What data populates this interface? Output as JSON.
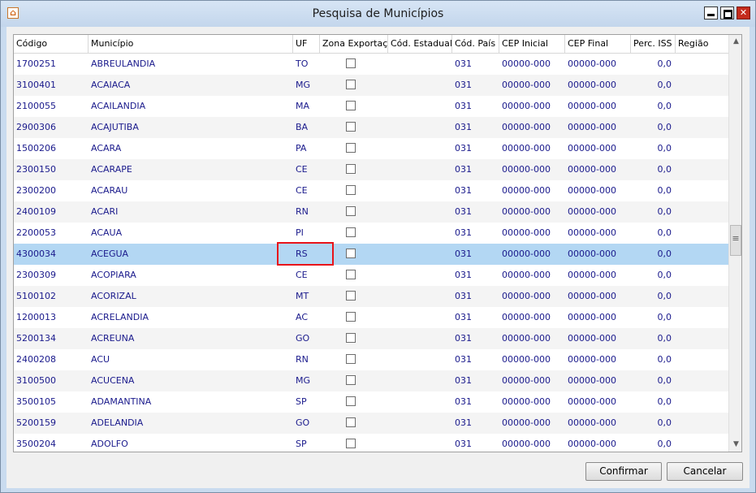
{
  "window": {
    "title": "Pesquisa de Municípios"
  },
  "titlebar_buttons": {
    "minimize": "minimize-icon",
    "maximize": "maximize-icon",
    "close": "✕"
  },
  "grid": {
    "columns": [
      "Código",
      "Município",
      "UF",
      "Zona Exportação",
      "Cód. Estadual",
      "Cód. País",
      "CEP Inicial",
      "CEP Final",
      "Perc. ISS",
      "Região"
    ],
    "selected_row_index": 9,
    "rows": [
      {
        "codigo": "1700251",
        "municipio": "ABREULANDIA",
        "uf": "TO",
        "zona": false,
        "cod_estadual": "",
        "cod_pais": "031",
        "cep_ini": "00000-000",
        "cep_fim": "00000-000",
        "iss": "0,0",
        "regiao": ""
      },
      {
        "codigo": "3100401",
        "municipio": "ACAIACA",
        "uf": "MG",
        "zona": false,
        "cod_estadual": "",
        "cod_pais": "031",
        "cep_ini": "00000-000",
        "cep_fim": "00000-000",
        "iss": "0,0",
        "regiao": ""
      },
      {
        "codigo": "2100055",
        "municipio": "ACAILANDIA",
        "uf": "MA",
        "zona": false,
        "cod_estadual": "",
        "cod_pais": "031",
        "cep_ini": "00000-000",
        "cep_fim": "00000-000",
        "iss": "0,0",
        "regiao": ""
      },
      {
        "codigo": "2900306",
        "municipio": "ACAJUTIBA",
        "uf": "BA",
        "zona": false,
        "cod_estadual": "",
        "cod_pais": "031",
        "cep_ini": "00000-000",
        "cep_fim": "00000-000",
        "iss": "0,0",
        "regiao": ""
      },
      {
        "codigo": "1500206",
        "municipio": "ACARA",
        "uf": "PA",
        "zona": false,
        "cod_estadual": "",
        "cod_pais": "031",
        "cep_ini": "00000-000",
        "cep_fim": "00000-000",
        "iss": "0,0",
        "regiao": ""
      },
      {
        "codigo": "2300150",
        "municipio": "ACARAPE",
        "uf": "CE",
        "zona": false,
        "cod_estadual": "",
        "cod_pais": "031",
        "cep_ini": "00000-000",
        "cep_fim": "00000-000",
        "iss": "0,0",
        "regiao": ""
      },
      {
        "codigo": "2300200",
        "municipio": "ACARAU",
        "uf": "CE",
        "zona": false,
        "cod_estadual": "",
        "cod_pais": "031",
        "cep_ini": "00000-000",
        "cep_fim": "00000-000",
        "iss": "0,0",
        "regiao": ""
      },
      {
        "codigo": "2400109",
        "municipio": "ACARI",
        "uf": "RN",
        "zona": false,
        "cod_estadual": "",
        "cod_pais": "031",
        "cep_ini": "00000-000",
        "cep_fim": "00000-000",
        "iss": "0,0",
        "regiao": ""
      },
      {
        "codigo": "2200053",
        "municipio": "ACAUA",
        "uf": "PI",
        "zona": false,
        "cod_estadual": "",
        "cod_pais": "031",
        "cep_ini": "00000-000",
        "cep_fim": "00000-000",
        "iss": "0,0",
        "regiao": ""
      },
      {
        "codigo": "4300034",
        "municipio": "ACEGUA",
        "uf": "RS",
        "zona": false,
        "cod_estadual": "",
        "cod_pais": "031",
        "cep_ini": "00000-000",
        "cep_fim": "00000-000",
        "iss": "0,0",
        "regiao": ""
      },
      {
        "codigo": "2300309",
        "municipio": "ACOPIARA",
        "uf": "CE",
        "zona": false,
        "cod_estadual": "",
        "cod_pais": "031",
        "cep_ini": "00000-000",
        "cep_fim": "00000-000",
        "iss": "0,0",
        "regiao": ""
      },
      {
        "codigo": "5100102",
        "municipio": "ACORIZAL",
        "uf": "MT",
        "zona": false,
        "cod_estadual": "",
        "cod_pais": "031",
        "cep_ini": "00000-000",
        "cep_fim": "00000-000",
        "iss": "0,0",
        "regiao": ""
      },
      {
        "codigo": "1200013",
        "municipio": "ACRELANDIA",
        "uf": "AC",
        "zona": false,
        "cod_estadual": "",
        "cod_pais": "031",
        "cep_ini": "00000-000",
        "cep_fim": "00000-000",
        "iss": "0,0",
        "regiao": ""
      },
      {
        "codigo": "5200134",
        "municipio": "ACREUNA",
        "uf": "GO",
        "zona": false,
        "cod_estadual": "",
        "cod_pais": "031",
        "cep_ini": "00000-000",
        "cep_fim": "00000-000",
        "iss": "0,0",
        "regiao": ""
      },
      {
        "codigo": "2400208",
        "municipio": "ACU",
        "uf": "RN",
        "zona": false,
        "cod_estadual": "",
        "cod_pais": "031",
        "cep_ini": "00000-000",
        "cep_fim": "00000-000",
        "iss": "0,0",
        "regiao": ""
      },
      {
        "codigo": "3100500",
        "municipio": "ACUCENA",
        "uf": "MG",
        "zona": false,
        "cod_estadual": "",
        "cod_pais": "031",
        "cep_ini": "00000-000",
        "cep_fim": "00000-000",
        "iss": "0,0",
        "regiao": ""
      },
      {
        "codigo": "3500105",
        "municipio": "ADAMANTINA",
        "uf": "SP",
        "zona": false,
        "cod_estadual": "",
        "cod_pais": "031",
        "cep_ini": "00000-000",
        "cep_fim": "00000-000",
        "iss": "0,0",
        "regiao": ""
      },
      {
        "codigo": "5200159",
        "municipio": "ADELANDIA",
        "uf": "GO",
        "zona": false,
        "cod_estadual": "",
        "cod_pais": "031",
        "cep_ini": "00000-000",
        "cep_fim": "00000-000",
        "iss": "0,0",
        "regiao": ""
      },
      {
        "codigo": "3500204",
        "municipio": "ADOLFO",
        "uf": "SP",
        "zona": false,
        "cod_estadual": "",
        "cod_pais": "031",
        "cep_ini": "00000-000",
        "cep_fim": "00000-000",
        "iss": "0,0",
        "regiao": ""
      }
    ]
  },
  "scrollbar": {
    "up": "▲",
    "down": "▼",
    "thumb": "≡"
  },
  "footer": {
    "confirm_label": "Confirmar",
    "cancel_label": "Cancelar"
  },
  "colors": {
    "selection": "#b3d7f3",
    "highlight_box": "#e8141a",
    "cell_text": "#1a1a8c"
  }
}
